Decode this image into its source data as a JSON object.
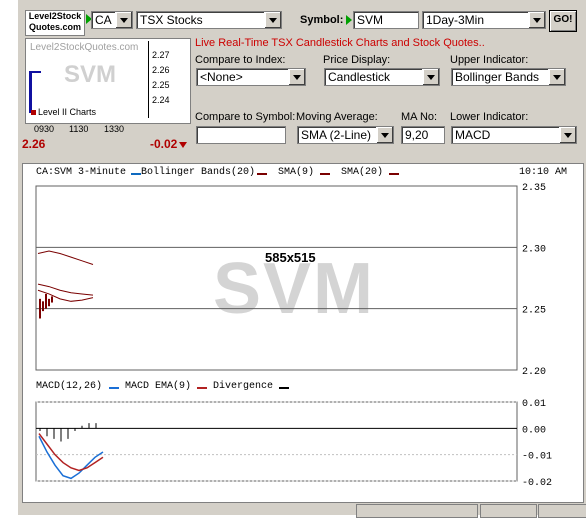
{
  "logo": {
    "line1": "Level2Stock",
    "line2": "Quotes.com"
  },
  "exchange_select": {
    "value": "CA"
  },
  "market_select": {
    "value": "TSX Stocks"
  },
  "symbol": {
    "label": "Symbol:",
    "value": "SVM"
  },
  "period_select": {
    "value": "1Day-3Min"
  },
  "go_button": {
    "label": "GO!"
  },
  "mini_chart": {
    "watermark": "Level2StockQuotes.com",
    "symbol_watermark": "SVM",
    "y_ticks": [
      "2.27",
      "2.26",
      "2.25",
      "2.24"
    ],
    "x_ticks": [
      "0930",
      "1130",
      "1330"
    ],
    "legend": "Level II Charts",
    "price": "2.26",
    "change": "-0.02"
  },
  "headline": "Live Real-Time TSX Candlestick Charts and Stock Quotes..",
  "controls": {
    "compare_index": {
      "label": "Compare to Index:",
      "value": "<None>"
    },
    "price_display": {
      "label": "Price Display:",
      "value": "Candlestick"
    },
    "upper_indicator": {
      "label": "Upper Indicator:",
      "value": "Bollinger Bands"
    },
    "compare_symbol": {
      "label": "Compare to Symbol:",
      "value": ""
    },
    "moving_average": {
      "label": "Moving Average:",
      "value": "SMA (2-Line)"
    },
    "ma_no": {
      "label": "MA No:",
      "value": "9,20"
    },
    "lower_indicator": {
      "label": "Lower Indicator:",
      "value": "MACD"
    }
  },
  "main_chart": {
    "legend": "CA:SVM 3-Minute",
    "legend_items": [
      "Bollinger Bands(20)",
      "SMA(9)",
      "SMA(20)"
    ],
    "time": "10:10 AM",
    "size_label": "585x515",
    "watermark": "SVM",
    "y_ticks": [
      "2.35",
      "2.30",
      "2.25",
      "2.20"
    ],
    "macd_legend": "MACD(12,26)",
    "macd_items": [
      "MACD EMA(9)",
      "Divergence"
    ],
    "macd_ticks": [
      "0.01",
      "0.00",
      "-0.01",
      "-0.02"
    ]
  },
  "colors": {
    "panel": "#d4d0c8",
    "bollinger": "#7a0000",
    "sma": "#7a0000",
    "macd": "#1a6fd6",
    "ema": "#b22222",
    "divergence": "#000000",
    "headline": "#cc0000"
  },
  "chart_data": [
    {
      "type": "line",
      "title": "CA:SVM 3-Minute",
      "ylim": [
        2.2,
        2.35
      ],
      "series": [
        {
          "name": "Bollinger Bands(20)",
          "values": [
            2.295,
            2.297,
            2.295,
            2.292,
            2.289,
            2.286
          ]
        },
        {
          "name": "SMA(9)",
          "values": [
            2.265,
            2.262,
            2.258,
            2.256,
            2.257,
            2.259
          ]
        },
        {
          "name": "SMA(20)",
          "values": [
            2.27,
            2.268,
            2.265,
            2.263,
            2.262,
            2.261
          ]
        }
      ]
    },
    {
      "type": "line",
      "title": "MACD(12,26)",
      "ylim": [
        -0.02,
        0.01
      ],
      "series": [
        {
          "name": "MACD(12,26)",
          "values": [
            -0.003,
            -0.009,
            -0.014,
            -0.018,
            -0.019,
            -0.017,
            -0.014,
            -0.011,
            -0.009
          ]
        },
        {
          "name": "MACD EMA(9)",
          "values": [
            -0.002,
            -0.006,
            -0.01,
            -0.013,
            -0.015,
            -0.016,
            -0.015,
            -0.013,
            -0.011
          ]
        }
      ]
    }
  ]
}
